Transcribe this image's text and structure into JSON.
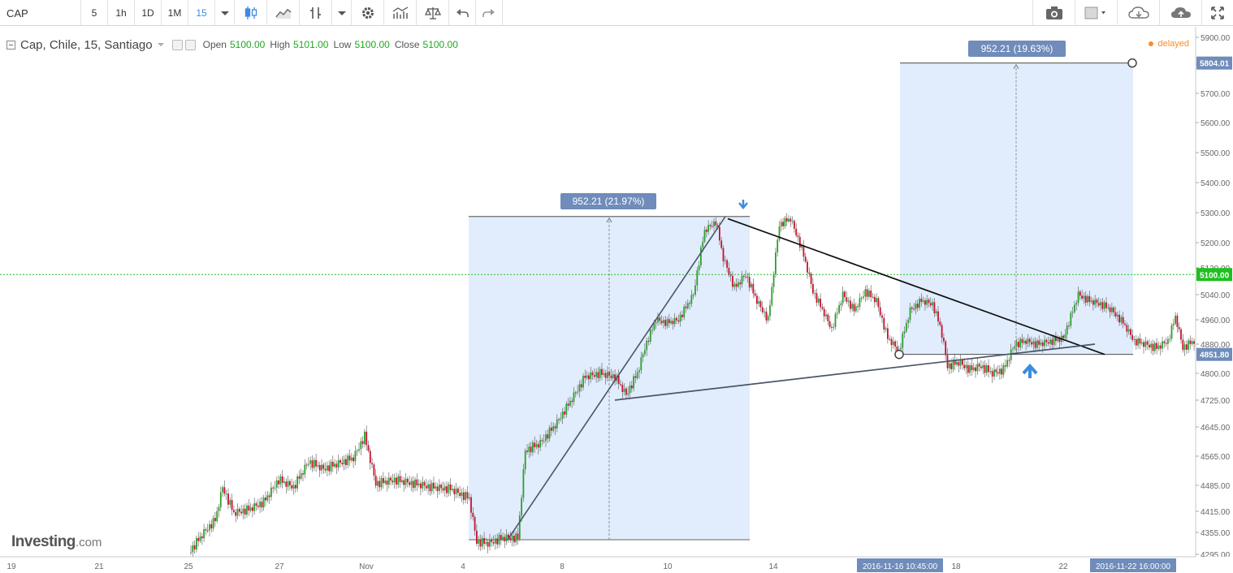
{
  "toolbar": {
    "symbol": "CAP",
    "intervals": [
      "5",
      "1h",
      "1D",
      "1M",
      "15"
    ],
    "active_interval": "15",
    "icons": [
      "candles-icon",
      "line-chart-icon",
      "draw-tool-icon",
      "settings-gear-icon",
      "indicators-icon",
      "compare-scale-icon",
      "undo-icon",
      "redo-icon"
    ],
    "right_icons": [
      "camera-icon",
      "color-box-icon",
      "cloud-download-icon",
      "cloud-upload-icon",
      "fullscreen-icon"
    ]
  },
  "legend": {
    "title": "Cap, Chile, 15, Santiago",
    "open_label": "Open",
    "open": "5100.00",
    "high_label": "High",
    "high": "5101.00",
    "low_label": "Low",
    "low": "5100.00",
    "close_label": "Close",
    "close": "5100.00",
    "delayed": "delayed"
  },
  "watermark": {
    "brand": "Investing",
    "suffix": ".com"
  },
  "colors": {
    "up": "#2ca02c",
    "down": "#c8102e",
    "box_fill": "#dceafb",
    "label_bg": "#6f8cba",
    "last_price": "#1fbf1f",
    "arrow": "#3d8be0"
  },
  "chart_data": {
    "type": "candlestick",
    "instrument": "Cap, Chile, 15, Santiago",
    "x_ticks": [
      "19",
      "21",
      "25",
      "27",
      "Nov",
      "4",
      "8",
      "10",
      "14",
      "18",
      "22"
    ],
    "y_ticks": [
      "4295.00",
      "4355.00",
      "4415.00",
      "4485.00",
      "4565.00",
      "4645.00",
      "4725.00",
      "4800.00",
      "4880.00",
      "4960.00",
      "5040.00",
      "5120.00",
      "5200.00",
      "5300.00",
      "5400.00",
      "5500.00",
      "5600.00",
      "5700.00",
      "5800.00",
      "5900.00"
    ],
    "ylim": [
      4290,
      5910
    ],
    "last_price": "5100.00",
    "price_label_top": "5804.01",
    "price_label_bottom": "4851.80",
    "time_label_start": "2016-11-16 10:45:00",
    "time_label_end": "2016-11-22 16:00:00",
    "measure_1": {
      "label": "952.21 (21.97%)",
      "low": 4335,
      "high": 5287
    },
    "measure_2": {
      "label": "952.21 (19.63%)",
      "low": 4851.8,
      "high": 5804.01
    },
    "price_path": [
      [
        0,
        4300
      ],
      [
        8,
        4355
      ],
      [
        14,
        4390
      ],
      [
        18,
        4480
      ],
      [
        24,
        4410
      ],
      [
        32,
        4420
      ],
      [
        40,
        4440
      ],
      [
        48,
        4500
      ],
      [
        56,
        4480
      ],
      [
        64,
        4550
      ],
      [
        72,
        4530
      ],
      [
        80,
        4545
      ],
      [
        88,
        4560
      ],
      [
        94,
        4620
      ],
      [
        100,
        4490
      ],
      [
        110,
        4500
      ],
      [
        120,
        4490
      ],
      [
        130,
        4480
      ],
      [
        140,
        4475
      ],
      [
        150,
        4450
      ],
      [
        154,
        4330
      ],
      [
        160,
        4325
      ],
      [
        168,
        4340
      ],
      [
        176,
        4340
      ],
      [
        180,
        4580
      ],
      [
        188,
        4600
      ],
      [
        196,
        4650
      ],
      [
        204,
        4720
      ],
      [
        212,
        4790
      ],
      [
        220,
        4800
      ],
      [
        228,
        4790
      ],
      [
        234,
        4740
      ],
      [
        240,
        4800
      ],
      [
        244,
        4870
      ],
      [
        250,
        4960
      ],
      [
        256,
        4950
      ],
      [
        262,
        4960
      ],
      [
        270,
        5040
      ],
      [
        276,
        5240
      ],
      [
        282,
        5270
      ],
      [
        286,
        5150
      ],
      [
        292,
        5060
      ],
      [
        298,
        5100
      ],
      [
        304,
        5020
      ],
      [
        310,
        4960
      ],
      [
        316,
        5260
      ],
      [
        322,
        5280
      ],
      [
        328,
        5180
      ],
      [
        334,
        5050
      ],
      [
        340,
        4980
      ],
      [
        344,
        4930
      ],
      [
        350,
        5040
      ],
      [
        356,
        4990
      ],
      [
        362,
        5050
      ],
      [
        368,
        5020
      ],
      [
        374,
        4900
      ],
      [
        380,
        4860
      ],
      [
        386,
        4990
      ],
      [
        392,
        5020
      ],
      [
        398,
        5010
      ],
      [
        402,
        4940
      ],
      [
        406,
        4820
      ],
      [
        412,
        4830
      ],
      [
        418,
        4810
      ],
      [
        424,
        4820
      ],
      [
        430,
        4800
      ],
      [
        436,
        4810
      ],
      [
        442,
        4880
      ],
      [
        448,
        4890
      ],
      [
        454,
        4880
      ],
      [
        462,
        4890
      ],
      [
        468,
        4900
      ],
      [
        476,
        5040
      ],
      [
        482,
        5020
      ],
      [
        488,
        5010
      ],
      [
        494,
        4990
      ],
      [
        500,
        4950
      ],
      [
        506,
        4890
      ],
      [
        512,
        4880
      ],
      [
        518,
        4870
      ],
      [
        524,
        4890
      ],
      [
        528,
        4970
      ],
      [
        532,
        4870
      ],
      [
        538,
        4890
      ],
      [
        542,
        4900
      ],
      [
        546,
        4960
      ],
      [
        552,
        5000
      ],
      [
        556,
        5100
      ],
      [
        560,
        5140
      ],
      [
        564,
        5100
      ]
    ]
  }
}
